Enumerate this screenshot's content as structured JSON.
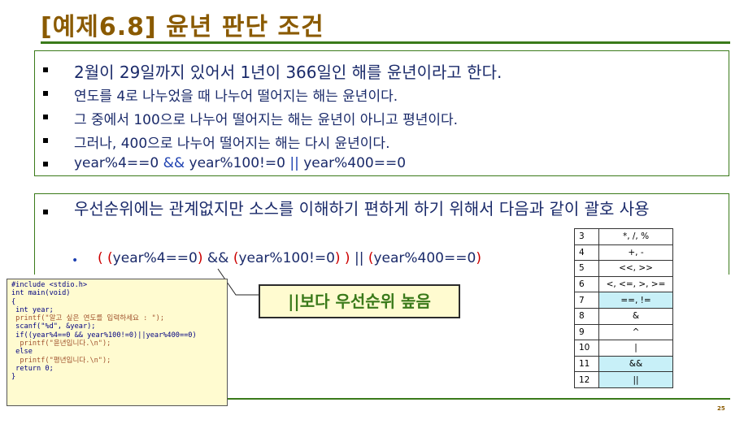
{
  "title": "[예제6.8] 윤년 판단 조건",
  "box1": {
    "items": [
      "2월이 29일까지 있어서 1년이 366일인 해를 윤년이라고 한다.",
      "연도를 4로 나누었을 때 나누어 떨어지는 해는 윤년이다.",
      "그 중에서 100으로 나누어 떨어지는 해는 윤년이 아니고 평년이다.",
      "그러나, 400으로 나누어 떨어지는 해는 다시 윤년이다."
    ],
    "expr": {
      "part1": "year%4==0 ",
      "op1": "&&",
      "part2": " year%100!=0 ",
      "op2": "||",
      "part3": " year%400==0"
    }
  },
  "box2": {
    "text": "우선순위에는 관계없지만 소스를 이해하기 편하게 하기 위해서 다음과 같이 괄호 사용",
    "sub": {
      "p1": "( (",
      "e1": "year%4==0",
      "p2": ")",
      "op1": " && ",
      "p3": "(",
      "e2": "year%100!=0",
      "p4": ") )",
      "op2": " || ",
      "p5": "(",
      "e3": "year%400==0",
      "p6": ")"
    }
  },
  "callout": "||보다 우선순위 높음",
  "code": [
    "#include <stdio.h>",
    "int main(void)",
    "{",
    " int year;",
    " printf(\"알고 싶은 연도를 입력하세요 : \");",
    " scanf(\"%d\", &year);",
    " if((year%4==0 && year%100!=0)||year%400==0)",
    "  printf(\"윤년입니다.\\n\");",
    " else",
    "  printf(\"평년입니다.\\n\");",
    " return 0;",
    "}"
  ],
  "precedence": [
    {
      "level": "3",
      "ops": "*, /, %"
    },
    {
      "level": "4",
      "ops": "+, -"
    },
    {
      "level": "5",
      "ops": "<<, >>"
    },
    {
      "level": "6",
      "ops": "<, <=, >, >="
    },
    {
      "level": "7",
      "ops": "==, !="
    },
    {
      "level": "8",
      "ops": "&"
    },
    {
      "level": "9",
      "ops": "^"
    },
    {
      "level": "10",
      "ops": "|"
    },
    {
      "level": "11",
      "ops": "&&"
    },
    {
      "level": "12",
      "ops": "||"
    }
  ],
  "page_number": "25",
  "colors": {
    "title": "#8a5a00",
    "rule": "#3a7a1a",
    "highlight": "#c8f0f8",
    "code_bg": "#fffbd0"
  }
}
